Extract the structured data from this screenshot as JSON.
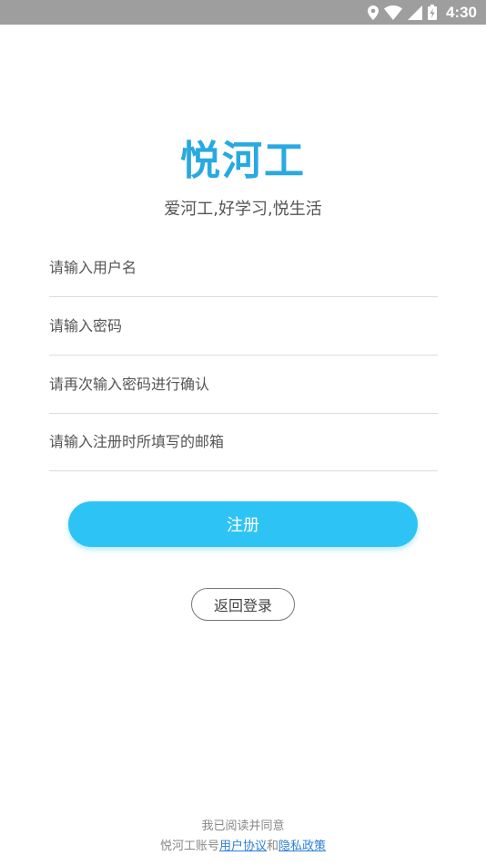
{
  "status_bar": {
    "time": "4:30",
    "icons": [
      "location-icon",
      "wifi-icon",
      "signal-icon",
      "battery-icon"
    ]
  },
  "app": {
    "title": "悦河工",
    "slogan": "爱河工,好学习,悦生活",
    "accent_color": "#29a9e1"
  },
  "form": {
    "username_placeholder": "请输入用户名",
    "password_placeholder": "请输入密码",
    "confirm_password_placeholder": "请再次输入密码进行确认",
    "email_placeholder": "请输入注册时所填写的邮箱",
    "register_label": "注册",
    "back_label": "返回登录",
    "button_color": "#2ec3f5"
  },
  "agreement": {
    "line1": "我已阅读并同意",
    "prefix": "悦河工账号",
    "user_agreement": "用户协议",
    "and": "和",
    "privacy_policy": "隐私政策",
    "link_color": "#2f7fd6"
  }
}
